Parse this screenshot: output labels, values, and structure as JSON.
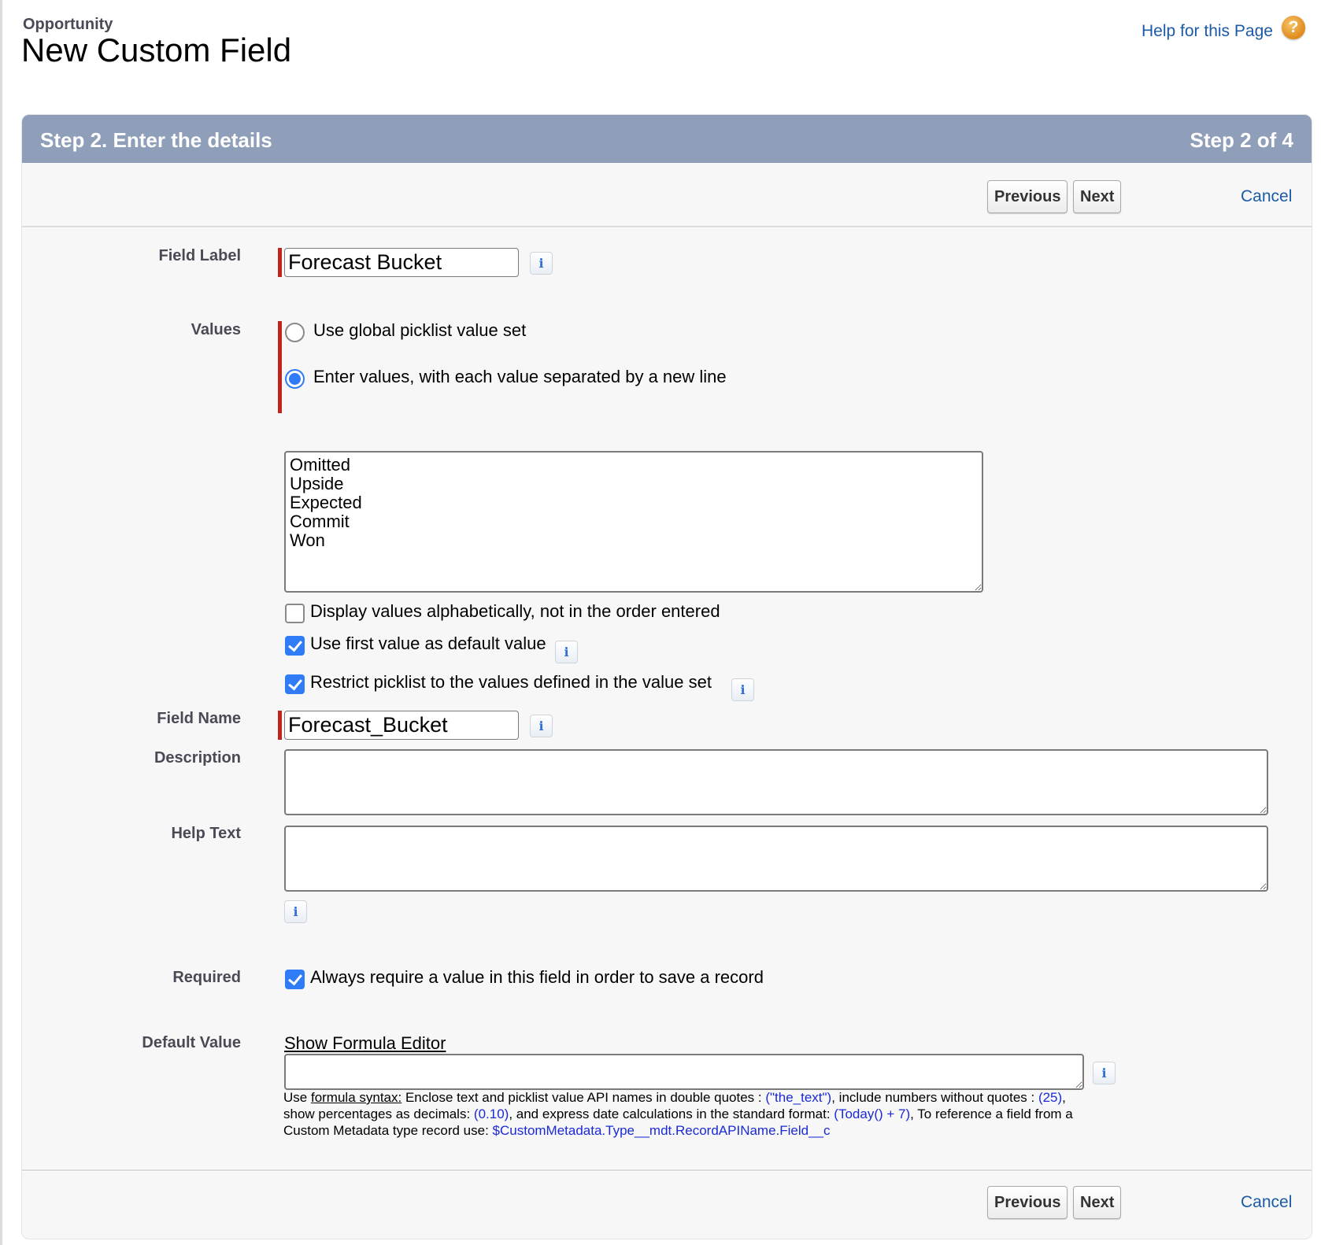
{
  "header": {
    "object_name": "Opportunity",
    "title": "New Custom Field",
    "help_link": "Help for this Page",
    "help_icon": "help-question-icon"
  },
  "wizard": {
    "step_title": "Step 2. Enter the details",
    "step_count": "Step 2 of 4",
    "previous_label": "Previous",
    "next_label": "Next",
    "cancel_label": "Cancel"
  },
  "form": {
    "field_label": {
      "label": "Field Label",
      "value": "Forecast Bucket",
      "required": true
    },
    "values": {
      "label": "Values",
      "required": true,
      "options": [
        {
          "label": "Use global picklist value set",
          "selected": false
        },
        {
          "label": "Enter values, with each value separated by a new line",
          "selected": true
        }
      ],
      "entered_values": [
        "Omitted",
        "Upside",
        "Expected",
        "Commit",
        "Won"
      ],
      "entered_values_text": "Omitted\nUpside\nExpected\nCommit\nWon",
      "checkboxes": [
        {
          "label": "Display values alphabetically, not in the order entered",
          "checked": false,
          "has_info": false
        },
        {
          "label": "Use first value as default value",
          "checked": true,
          "has_info": true
        },
        {
          "label": "Restrict picklist to the values defined in the value set",
          "checked": true,
          "has_info": true
        }
      ]
    },
    "field_name": {
      "label": "Field Name",
      "value": "Forecast_Bucket",
      "required": true
    },
    "description": {
      "label": "Description",
      "value": ""
    },
    "help_text": {
      "label": "Help Text",
      "value": ""
    },
    "required": {
      "label": "Required",
      "checkbox_label": "Always require a value in this field in order to save a record",
      "checked": true
    },
    "default_value": {
      "label": "Default Value",
      "formula_editor_link": "Show Formula Editor",
      "value": "",
      "hint": {
        "prefix": "Use ",
        "syntax_link": "formula syntax:",
        "part1": " Enclose text and picklist value API names in double quotes : ",
        "code1": "(\"the_text\")",
        "part2": ", include numbers without quotes : ",
        "code2": "(25)",
        "part3": ", show percentages as decimals: ",
        "code3": "(0.10)",
        "part4": ", and express date calculations in the standard format: ",
        "code4": "(Today() + 7)",
        "part5": ", To reference a field from a Custom Metadata type record use: ",
        "code5": "$CustomMetadata.Type__mdt.RecordAPIName.Field__c"
      }
    }
  },
  "colors": {
    "header_bar": "#8f9eb9",
    "required_bar": "#c0241c",
    "link": "#1a5aa6",
    "checkbox_checked": "#2f7cf6",
    "code_text": "#1a2ad6"
  }
}
